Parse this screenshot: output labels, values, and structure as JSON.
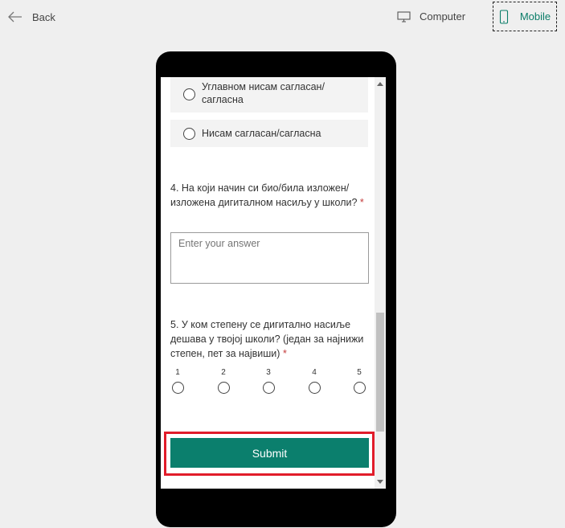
{
  "topbar": {
    "back_label": "Back",
    "computer_label": "Computer",
    "mobile_label": "Mobile"
  },
  "form": {
    "options": [
      {
        "label": "Углавном нисам сагласан/ сагласна"
      },
      {
        "label": "Нисам сагласан/сагласна"
      }
    ],
    "q4": {
      "text": "4. На који начин си био/била изложен/ изложена дигиталном насиљу у школи?",
      "required_mark": "*",
      "answer_placeholder": "Enter your answer"
    },
    "q5": {
      "text": "5. У ком степену се дигитално насиље дешава у твојој школи? (један за најнижи степен, пет за највиши)",
      "required_mark": "*",
      "scale": [
        "1",
        "2",
        "3",
        "4",
        "5"
      ]
    },
    "submit_label": "Submit"
  },
  "colors": {
    "accent": "#0b7f6d",
    "highlight_frame": "#e11c2a",
    "required": "#c43b3b"
  }
}
